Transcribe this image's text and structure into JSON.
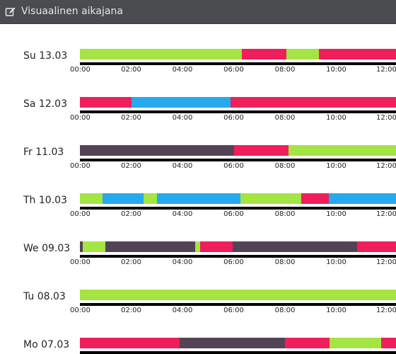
{
  "header": {
    "title": "Visuaalinen aikajana",
    "icon": "edit-icon"
  },
  "colors": {
    "green": "#a4e443",
    "red": "#f01e5a",
    "blue": "#25a9ef",
    "purple": "#544354",
    "header_bg": "#4a4c50",
    "axis": "#000000"
  },
  "tick_labels": [
    "00:00",
    "02:00",
    "04:00",
    "06:00",
    "08:00",
    "10:00",
    "12:00"
  ],
  "days": [
    {
      "label": "Su 13.03",
      "segments": [
        {
          "start": 0,
          "end": 3.6,
          "c": "green"
        },
        {
          "start": 3.6,
          "end": 6.33,
          "c": "green"
        },
        {
          "start": 6.33,
          "end": 8.05,
          "c": "red"
        },
        {
          "start": 8.05,
          "end": 9.33,
          "c": "green"
        },
        {
          "start": 9.33,
          "end": 12.5,
          "c": "red"
        }
      ]
    },
    {
      "label": "Sa 12.03",
      "segments": [
        {
          "start": 0,
          "end": 2.0,
          "c": "red"
        },
        {
          "start": 2.0,
          "end": 5.87,
          "c": "blue"
        },
        {
          "start": 5.87,
          "end": 12.5,
          "c": "red"
        }
      ]
    },
    {
      "label": "Fr 11.03",
      "segments": [
        {
          "start": 0,
          "end": 6.0,
          "c": "purple"
        },
        {
          "start": 6.0,
          "end": 7.75,
          "c": "red"
        },
        {
          "start": 7.75,
          "end": 8.13,
          "c": "red"
        },
        {
          "start": 8.13,
          "end": 11.0,
          "c": "green"
        },
        {
          "start": 11.0,
          "end": 12.5,
          "c": "green"
        }
      ]
    },
    {
      "label": "Th 10.03",
      "segments": [
        {
          "start": 0,
          "end": 0.88,
          "c": "green"
        },
        {
          "start": 0.88,
          "end": 2.47,
          "c": "blue"
        },
        {
          "start": 2.47,
          "end": 2.97,
          "c": "green"
        },
        {
          "start": 2.97,
          "end": 3.0,
          "c": "green"
        },
        {
          "start": 3.0,
          "end": 6.25,
          "c": "blue"
        },
        {
          "start": 6.25,
          "end": 7.88,
          "c": "green"
        },
        {
          "start": 7.88,
          "end": 8.63,
          "c": "green"
        },
        {
          "start": 8.63,
          "end": 9.7,
          "c": "red"
        },
        {
          "start": 9.7,
          "end": 12.5,
          "c": "blue"
        }
      ]
    },
    {
      "label": "We 09.03",
      "segments": [
        {
          "start": 0,
          "end": 0.1,
          "c": "purple"
        },
        {
          "start": 0.1,
          "end": 1.0,
          "c": "green"
        },
        {
          "start": 1.0,
          "end": 4.5,
          "c": "purple"
        },
        {
          "start": 4.5,
          "end": 4.68,
          "c": "green"
        },
        {
          "start": 4.68,
          "end": 5.97,
          "c": "red"
        },
        {
          "start": 5.97,
          "end": 9.6,
          "c": "purple"
        },
        {
          "start": 9.6,
          "end": 10.8,
          "c": "purple"
        },
        {
          "start": 10.8,
          "end": 12.5,
          "c": "red"
        }
      ]
    },
    {
      "label": "Tu 08.03",
      "segments": [
        {
          "start": 0,
          "end": 9.4,
          "c": "green"
        },
        {
          "start": 9.4,
          "end": 12.5,
          "c": "green"
        }
      ]
    },
    {
      "label": "Mo 07.03",
      "segments": [
        {
          "start": 0,
          "end": 3.88,
          "c": "red"
        },
        {
          "start": 3.88,
          "end": 8.0,
          "c": "purple"
        },
        {
          "start": 8.0,
          "end": 9.75,
          "c": "red"
        },
        {
          "start": 9.75,
          "end": 11.75,
          "c": "green"
        },
        {
          "start": 11.75,
          "end": 12.5,
          "c": "red"
        }
      ]
    }
  ]
}
